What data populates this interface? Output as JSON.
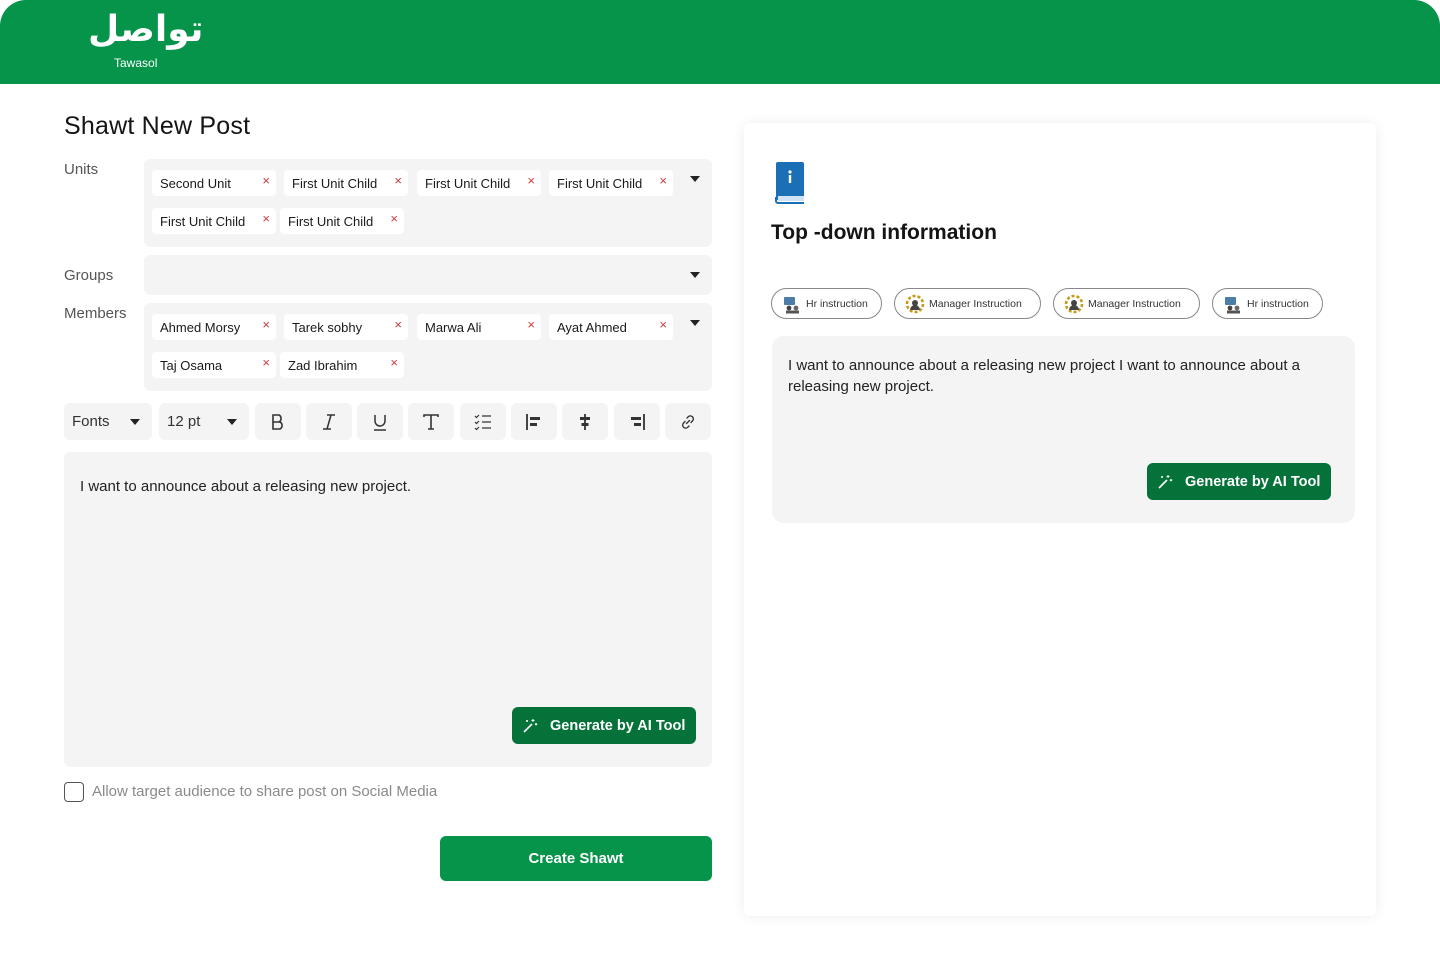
{
  "header": {
    "logo_arabic": "تواصل",
    "logo_text": "Tawasol",
    "brand_color": "#06934a"
  },
  "page": {
    "title": "Shawt New Post"
  },
  "form": {
    "units_label": "Units",
    "units": [
      "Second Unit",
      "First Unit Child",
      "First Unit Child",
      "First Unit Child",
      "First Unit Child",
      "First Unit Child"
    ],
    "groups_label": "Groups",
    "groups": [],
    "members_label": "Members",
    "members": [
      "Ahmed Morsy",
      "Tarek sobhy",
      "Marwa Ali",
      "Ayat Ahmed",
      "Taj Osama",
      "Zad Ibrahim"
    ],
    "remove_glyph": "×"
  },
  "toolbar": {
    "font_value": "Fonts",
    "size_value": "12 pt",
    "buttons": [
      "bold-icon",
      "italic-icon",
      "underline-icon",
      "text-icon",
      "checklist-icon",
      "align-left-icon",
      "align-center-icon",
      "align-right-icon",
      "link-icon"
    ]
  },
  "editor": {
    "content": "I want to announce about a releasing new project.",
    "ai_button_label": "Generate by AI Tool"
  },
  "share": {
    "checked": false,
    "label": "Allow target audience to share post on Social Media"
  },
  "actions": {
    "create_label": "Create Shawt"
  },
  "side_panel": {
    "title": "Top -down information",
    "instructions": [
      {
        "label": "Hr instruction",
        "icon": "hr-icon"
      },
      {
        "label": "Manager Instruction",
        "icon": "manager-gear-icon"
      },
      {
        "label": "Manager Instruction",
        "icon": "manager-gear-icon"
      },
      {
        "label": "Hr instruction",
        "icon": "hr-icon"
      }
    ],
    "card_text": "I want to announce about a releasing new project I want to announce about a releasing new project.",
    "ai_button_label": "Generate by AI Tool"
  }
}
